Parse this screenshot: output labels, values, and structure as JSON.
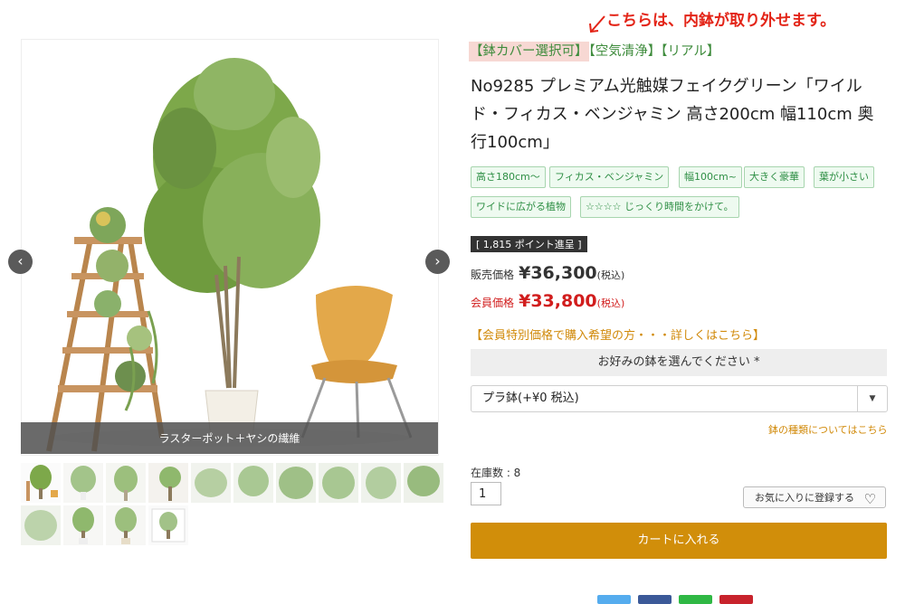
{
  "gallery": {
    "caption": "ラスターポット＋ヤシの繊維",
    "prev_icon": "chevron-left-icon",
    "next_icon": "chevron-right-icon"
  },
  "annotation": "こちらは、内鉢が取り外せます。",
  "tags": {
    "highlighted": "【鉢カバー選択可】",
    "rest": "【空気清浄】【リアル】"
  },
  "product": {
    "title": "No9285 プレミアム光触媒フェイクグリーン「ワイルド・フィカス・ベンジャミン 高さ200cm 幅110cm 奥行100cm」"
  },
  "chips": [
    "高さ180cm～",
    "フィカス・ベンジャミン",
    "幅100cm~",
    "大きく豪華",
    "葉が小さい",
    "ワイドに広がる植物",
    "☆☆☆☆ じっくり時間をかけて。"
  ],
  "points": "[ 1,815 ポイント進呈 ]",
  "price": {
    "sale_label": "販売価格",
    "sale_value": "¥36,300",
    "sale_tax": "(税込)",
    "member_label": "会員価格",
    "member_value": "¥33,800",
    "member_tax": "(税込)"
  },
  "member_link": "【会員特別価格で購入希望の方・・・詳しくはこちら】",
  "pot": {
    "header": "お好みの鉢を選んでください *",
    "selected": "プラ鉢(+¥0 税込)",
    "info_link": "鉢の種類についてはこちら"
  },
  "stock_label": "在庫数 : 8",
  "quantity": "1",
  "favorite_label": "お気に入りに登録する",
  "cart_label": "カートに入れる",
  "colors": {
    "accent": "#d18e0a",
    "member_red": "#d11d1d",
    "tag_green": "#3f8c3d",
    "annotation_red": "#e32417"
  }
}
